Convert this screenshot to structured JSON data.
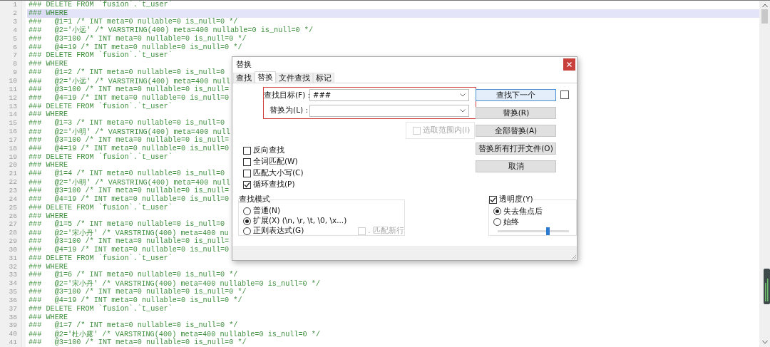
{
  "editor": {
    "lines": [
      {
        "number": "1",
        "text": "### DELETE FROM `fusion`.`t_user`",
        "current": false
      },
      {
        "number": "2",
        "text": "### WHERE",
        "current": true
      },
      {
        "number": "3",
        "text": "###   @1=1 /* INT meta=0 nullable=0 is_null=0 */",
        "current": false
      },
      {
        "number": "4",
        "text": "###   @2='小远' /* VARSTRING(400) meta=400 nullable=0 is_null=0 */",
        "current": false
      },
      {
        "number": "5",
        "text": "###   @3=100 /* INT meta=0 nullable=0 is_null=0 */",
        "current": false
      },
      {
        "number": "6",
        "text": "###   @4=19 /* INT meta=0 nullable=0 is_null=0 */",
        "current": false
      },
      {
        "number": "7",
        "text": "### DELETE FROM `fusion`.`t_user`",
        "current": false
      },
      {
        "number": "8",
        "text": "### WHERE",
        "current": false
      },
      {
        "number": "9",
        "text": "###   @1=2 /* INT meta=0 nullable=0 is_null=0",
        "current": false
      },
      {
        "number": "10",
        "text": "###   @2='小远' /* VARSTRING(400) meta=400 null",
        "current": false
      },
      {
        "number": "11",
        "text": "###   @3=100 /* INT meta=0 nullable=0 is_null=",
        "current": false
      },
      {
        "number": "12",
        "text": "###   @4=19 /* INT meta=0 nullable=0 is_null=0",
        "current": false
      },
      {
        "number": "13",
        "text": "### DELETE FROM `fusion`.`t_user`",
        "current": false
      },
      {
        "number": "14",
        "text": "### WHERE",
        "current": false
      },
      {
        "number": "15",
        "text": "###   @1=3 /* INT meta=0 nullable=0 is_null=0",
        "current": false
      },
      {
        "number": "16",
        "text": "###   @2='小明' /* VARSTRING(400) meta=400 null",
        "current": false
      },
      {
        "number": "17",
        "text": "###   @3=100 /* INT meta=0 nullable=0 is_null=",
        "current": false
      },
      {
        "number": "18",
        "text": "###   @4=19 /* INT meta=0 nullable=0 is_null=0",
        "current": false
      },
      {
        "number": "19",
        "text": "### DELETE FROM `fusion`.`t_user`",
        "current": false
      },
      {
        "number": "20",
        "text": "### WHERE",
        "current": false
      },
      {
        "number": "21",
        "text": "###   @1=4 /* INT meta=0 nullable=0 is_null=0",
        "current": false
      },
      {
        "number": "22",
        "text": "###   @2='小明' /* VARSTRING(400) meta=400 null",
        "current": false
      },
      {
        "number": "23",
        "text": "###   @3=100 /* INT meta=0 nullable=0 is_null=",
        "current": false
      },
      {
        "number": "24",
        "text": "###   @4=19 /* INT meta=0 nullable=0 is_null=0",
        "current": false
      },
      {
        "number": "25",
        "text": "### DELETE FROM `fusion`.`t_user`",
        "current": false
      },
      {
        "number": "26",
        "text": "### WHERE",
        "current": false
      },
      {
        "number": "27",
        "text": "###   @1=5 /* INT meta=0 nullable=0 is_null=0",
        "current": false
      },
      {
        "number": "28",
        "text": "###   @2='宋小丹' /* VARSTRING(400) meta=400 nu",
        "current": false
      },
      {
        "number": "29",
        "text": "###   @3=100 /* INT meta=0 nullable=0 is_null=",
        "current": false
      },
      {
        "number": "30",
        "text": "###   @4=19 /* INT meta=0 nullable=0 is_null=0",
        "current": false
      },
      {
        "number": "31",
        "text": "### DELETE FROM `fusion`.`t_user`",
        "current": false
      },
      {
        "number": "32",
        "text": "### WHERE",
        "current": false
      },
      {
        "number": "33",
        "text": "###   @1=6 /* INT meta=0 nullable=0 is_null=0 */",
        "current": false
      },
      {
        "number": "34",
        "text": "###   @2='宋小丹' /* VARSTRING(400) meta=400 nullable=0 is_null=0 */",
        "current": false
      },
      {
        "number": "35",
        "text": "###   @3=100 /* INT meta=0 nullable=0 is_null=0 */",
        "current": false
      },
      {
        "number": "36",
        "text": "###   @4=19 /* INT meta=0 nullable=0 is_null=0 */",
        "current": false
      },
      {
        "number": "37",
        "text": "### DELETE FROM `fusion`.`t_user`",
        "current": false
      },
      {
        "number": "38",
        "text": "### WHERE",
        "current": false
      },
      {
        "number": "39",
        "text": "###   @1=7 /* INT meta=0 nullable=0 is_null=0 */",
        "current": false
      },
      {
        "number": "40",
        "text": "###   @2='杜小露' /* VARSTRING(400) meta=400 nullable=0 is_null=0 */",
        "current": false
      },
      {
        "number": "41",
        "text": "###   @3=100 /* INT meta=0 nullable=0 is_null=0 */",
        "current": false
      }
    ]
  },
  "dialog": {
    "title": "替换",
    "tabs": [
      {
        "label": "查找",
        "selected": false
      },
      {
        "label": "替换",
        "selected": true
      },
      {
        "label": "文件查找",
        "selected": false
      },
      {
        "label": "标记",
        "selected": false
      }
    ],
    "find_label": "查找目标(F) :",
    "find_value": "###",
    "replace_label": "替换为(L) :",
    "in_selection": {
      "label": "选取范围内(I)",
      "checked": false,
      "disabled": true
    },
    "buttons": [
      {
        "label": "查找下一个",
        "default": true
      },
      {
        "label": "替换(R)",
        "default": false
      },
      {
        "label": "全部替换(A)",
        "default": false
      },
      {
        "label": "替换所有打开文件(O)",
        "default": false
      },
      {
        "label": "取消",
        "default": false
      }
    ],
    "side_checkbox": {
      "checked": false
    },
    "options": [
      {
        "label": "反向查找",
        "checked": false
      },
      {
        "label": "全词匹配(W)",
        "checked": false
      },
      {
        "label": "匹配大小写(C)",
        "checked": false
      },
      {
        "label": "循环查找(P)",
        "checked": true
      }
    ],
    "search_mode": {
      "title": "查找模式",
      "options": [
        {
          "label": "普通(N)",
          "selected": false
        },
        {
          "label": "扩展(X) (\\n, \\r, \\t, \\0, \\x...)",
          "selected": true
        },
        {
          "label": "正则表达式(G)",
          "selected": false
        }
      ],
      "dot_newline": {
        "label": ". 匹配新行",
        "checked": false,
        "disabled": true
      }
    },
    "transparency": {
      "label": "透明度(Y)",
      "checked": true,
      "options": [
        {
          "label": "失去焦点后",
          "selected": true
        },
        {
          "label": "始终",
          "selected": false
        }
      ],
      "level": 0.7
    }
  }
}
